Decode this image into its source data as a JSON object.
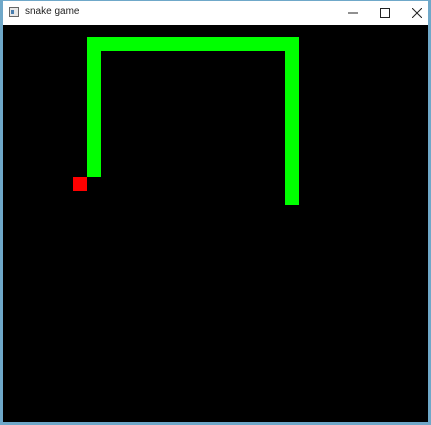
{
  "window": {
    "title": "snake game"
  },
  "controls": {
    "minimize_icon": "minimize-icon",
    "maximize_icon": "maximize-icon",
    "close_icon": "close-icon"
  },
  "game": {
    "background_color": "#000000",
    "snake_color": "#00ff00",
    "food_color": "#ff0000"
  }
}
